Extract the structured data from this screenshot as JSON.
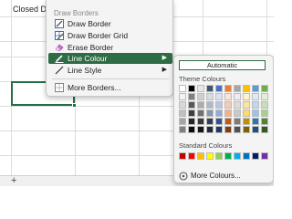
{
  "sheet": {
    "cell_text": "Closed De"
  },
  "menu": {
    "header": "Draw Borders",
    "items": [
      {
        "label": "Draw Border",
        "icon": "draw-border-icon"
      },
      {
        "label": "Draw Border Grid",
        "icon": "draw-border-grid-icon"
      },
      {
        "label": "Erase Border",
        "icon": "eraser-icon"
      },
      {
        "label": "Line Colour",
        "icon": "pencil-icon"
      },
      {
        "label": "Line Style",
        "icon": "line-style-icon"
      },
      {
        "label": "More Borders...",
        "icon": "borders-grid-icon"
      }
    ]
  },
  "palette": {
    "automatic": "Automatic",
    "theme_label": "Theme Colours",
    "standard_label": "Standard Colours",
    "more": "More Colours...",
    "theme_colors": [
      [
        "#ffffff",
        "#000000",
        "#e7e6e6",
        "#44546a",
        "#4472c4",
        "#ed7d31",
        "#a5a5a5",
        "#ffc000",
        "#5b9bd5",
        "#70ad47"
      ],
      [
        "#f2f2f2",
        "#7f7f7f",
        "#d0cece",
        "#d6dce4",
        "#d9e2f3",
        "#fbe5d5",
        "#ededed",
        "#fff2cc",
        "#deebf6",
        "#e2efd9"
      ],
      [
        "#d8d8d8",
        "#595959",
        "#aeabab",
        "#adb9ca",
        "#b4c6e7",
        "#f7cbac",
        "#dbdbdb",
        "#fee599",
        "#bdd7ee",
        "#c5e0b3"
      ],
      [
        "#bfbfbf",
        "#3f3f3f",
        "#757070",
        "#8496b0",
        "#8eaadb",
        "#f4b183",
        "#c9c9c9",
        "#ffd965",
        "#9cc3e5",
        "#a8d08d"
      ],
      [
        "#a5a5a5",
        "#262626",
        "#3a3838",
        "#323f4f",
        "#2f5496",
        "#c55a11",
        "#7b7b7b",
        "#bf9000",
        "#2e75b5",
        "#538135"
      ],
      [
        "#7f7f7f",
        "#0c0c0c",
        "#171616",
        "#222a35",
        "#1f3864",
        "#833c0b",
        "#525252",
        "#7f6000",
        "#1e4e79",
        "#375623"
      ]
    ],
    "standard_colors": [
      "#c00000",
      "#ff0000",
      "#ffc000",
      "#ffff00",
      "#92d050",
      "#00b050",
      "#00b0f0",
      "#0070c0",
      "#002060",
      "#7030a0"
    ]
  }
}
